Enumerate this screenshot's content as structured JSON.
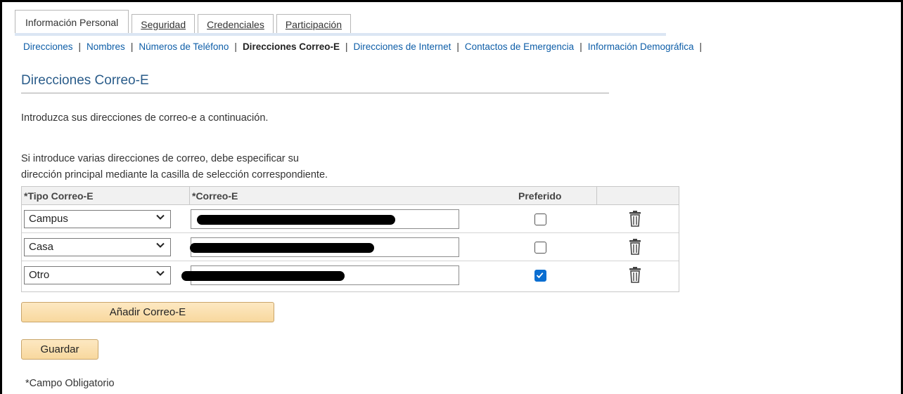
{
  "tabs": [
    {
      "label": "Información Personal",
      "active": true
    },
    {
      "label": "Seguridad",
      "active": false
    },
    {
      "label": "Credenciales",
      "active": false
    },
    {
      "label": "Participación",
      "active": false
    }
  ],
  "subnav": [
    {
      "label": "Direcciones"
    },
    {
      "label": "Nombres"
    },
    {
      "label": "Números de Teléfono"
    },
    {
      "label": "Direcciones Correo-E",
      "current": true
    },
    {
      "label": "Direcciones de Internet"
    },
    {
      "label": "Contactos de Emergencia"
    },
    {
      "label": "Información Demográfica"
    }
  ],
  "page": {
    "title": "Direcciones Correo-E",
    "intro": "Introduzca sus direcciones de correo-e a continuación.",
    "instruction_line1": "Si introduce varias direcciones de correo, debe especificar su",
    "instruction_line2": "dirección principal mediante la casilla de selección correspondiente."
  },
  "table": {
    "headers": {
      "type": "*Tipo Correo-E",
      "email": "*Correo-E",
      "preferred": "Preferido"
    },
    "rows": [
      {
        "type": "Campus",
        "email": "",
        "preferred": false
      },
      {
        "type": "Casa",
        "email": "",
        "preferred": false
      },
      {
        "type": "Otro",
        "email": "",
        "preferred": true
      }
    ]
  },
  "buttons": {
    "add": "Añadir Correo-E",
    "save": "Guardar"
  },
  "footer": {
    "required_note": "*Campo Obligatorio"
  },
  "colors": {
    "link": "#0e5ea8",
    "title": "#2a5c8a",
    "checkbox_on": "#0a6ed1",
    "button": "#f8d89e"
  }
}
